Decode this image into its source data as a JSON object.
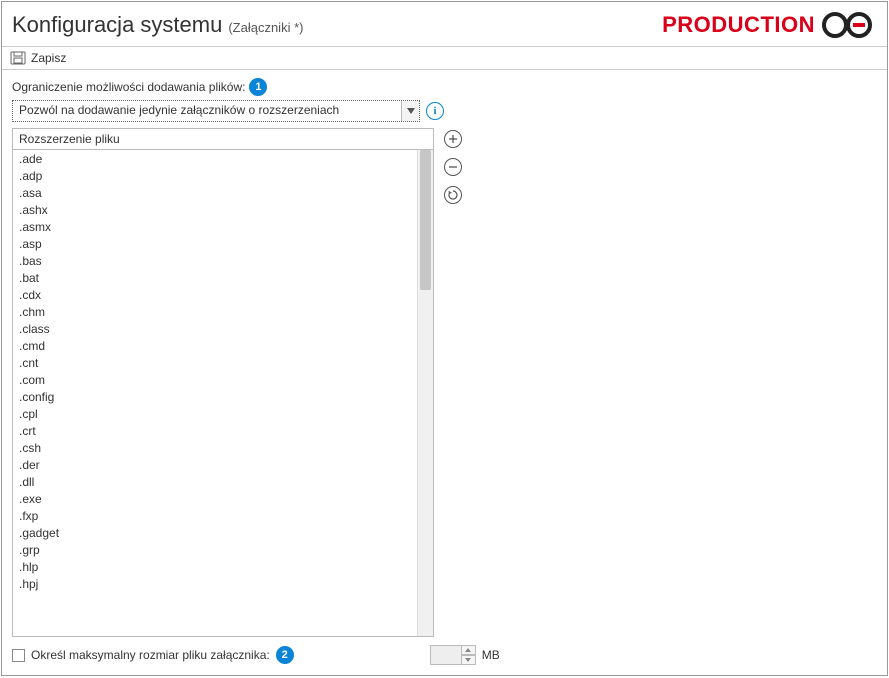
{
  "header": {
    "title": "Konfiguracja systemu",
    "subtitle": "(Załączniki *)",
    "brand_text": "PRODUCTION"
  },
  "toolbar": {
    "save_label": "Zapisz"
  },
  "restriction": {
    "label": "Ograniczenie możliwości dodawania plików:",
    "badge": "1",
    "selected": "Pozwól na dodawanie jedynie załączników o rozszerzeniach"
  },
  "info_icon_glyph": "i",
  "table": {
    "column_header": "Rozszerzenie pliku",
    "rows": [
      ".ade",
      ".adp",
      ".asa",
      ".ashx",
      ".asmx",
      ".asp",
      ".bas",
      ".bat",
      ".cdx",
      ".chm",
      ".class",
      ".cmd",
      ".cnt",
      ".com",
      ".config",
      ".cpl",
      ".crt",
      ".csh",
      ".der",
      ".dll",
      ".exe",
      ".fxp",
      ".gadget",
      ".grp",
      ".hlp",
      ".hpj"
    ]
  },
  "side_buttons": {
    "add": "+",
    "remove": "−",
    "refresh": "↻"
  },
  "max_size": {
    "checkbox_label": "Określ maksymalny rozmiar pliku załącznika:",
    "badge": "2",
    "value": "",
    "unit": "MB"
  }
}
